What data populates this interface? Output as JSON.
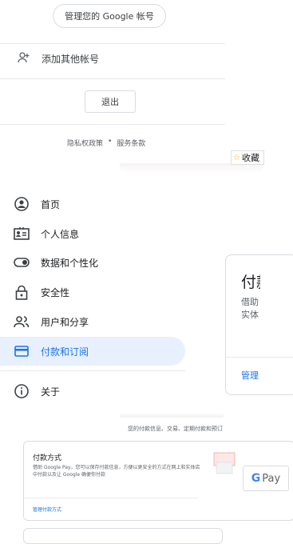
{
  "account_menu": {
    "manage_account": "管理您的 Google 帐号",
    "add_account": "添加其他帐号",
    "sign_out": "退出",
    "privacy": "隐私权政策",
    "dot": "•",
    "terms": "服务条款"
  },
  "bookmark": {
    "label": "收藏",
    "icon": "star-icon"
  },
  "nav": {
    "items": [
      {
        "label": "首页",
        "icon": "account-circle-icon"
      },
      {
        "label": "个人信息",
        "icon": "id-card-icon"
      },
      {
        "label": "数据和个性化",
        "icon": "toggle-icon"
      },
      {
        "label": "安全性",
        "icon": "lock-icon"
      },
      {
        "label": "用户和分享",
        "icon": "people-icon"
      },
      {
        "label": "付款和订阅",
        "icon": "credit-card-icon",
        "active": true
      },
      {
        "label": "关于",
        "icon": "info-icon"
      }
    ]
  },
  "right_card": {
    "title": "付款",
    "desc": "借助 实体",
    "link": "管理"
  },
  "lower": {
    "subtitle": "您的付款信息、交易、定期付款和预订",
    "pay_title": "付款方式",
    "pay_desc": "借助 Google Pay，您可以保存付款信息，方便以更安全的方式在网上和实体店中付款以及让 Google 确便你付款",
    "pay_link": "管理付款方式",
    "gpay_label": "Pay"
  },
  "colors": {
    "accent": "#1a73e8",
    "active_bg": "#e8f0fe"
  }
}
